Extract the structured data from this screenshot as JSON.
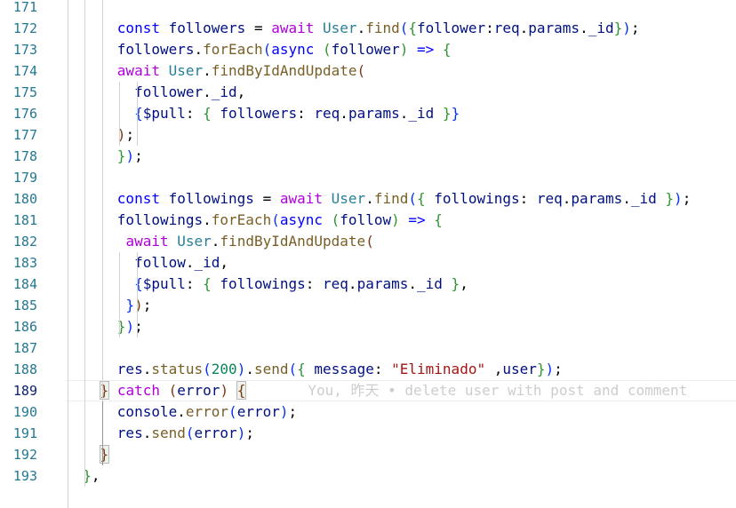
{
  "editor": {
    "colors": {
      "background": "#ffffff",
      "line_number": "#237893",
      "line_number_active": "#0b216f",
      "indent_guide": "#d3d3d3",
      "keyword": "#0000ff",
      "control": "#af00db",
      "variable": "#001080",
      "class": "#267f99",
      "function": "#795e26",
      "string": "#a31515",
      "number": "#098658"
    },
    "lines": [
      {
        "num": "171",
        "tokens": []
      },
      {
        "num": "172",
        "tokens": [
          {
            "t": "      "
          },
          {
            "t": "const",
            "c": "t-kw"
          },
          {
            "t": " "
          },
          {
            "t": "followers",
            "c": "t-var"
          },
          {
            "t": " = "
          },
          {
            "t": "await",
            "c": "t-ctl"
          },
          {
            "t": " "
          },
          {
            "t": "User",
            "c": "t-cls"
          },
          {
            "t": "."
          },
          {
            "t": "find",
            "c": "t-fn"
          },
          {
            "t": "(",
            "c": "t-b1"
          },
          {
            "t": "{",
            "c": "t-b2"
          },
          {
            "t": "follower",
            "c": "t-var"
          },
          {
            "t": ":"
          },
          {
            "t": "req",
            "c": "t-var"
          },
          {
            "t": "."
          },
          {
            "t": "params",
            "c": "t-var"
          },
          {
            "t": "."
          },
          {
            "t": "_id",
            "c": "t-var"
          },
          {
            "t": "}",
            "c": "t-b2"
          },
          {
            "t": ")",
            "c": "t-b1"
          },
          {
            "t": ";"
          }
        ]
      },
      {
        "num": "173",
        "tokens": [
          {
            "t": "      "
          },
          {
            "t": "followers",
            "c": "t-var"
          },
          {
            "t": "."
          },
          {
            "t": "forEach",
            "c": "t-fn"
          },
          {
            "t": "(",
            "c": "t-b1"
          },
          {
            "t": "async",
            "c": "t-kw"
          },
          {
            "t": " "
          },
          {
            "t": "(",
            "c": "t-b2"
          },
          {
            "t": "follower",
            "c": "t-var"
          },
          {
            "t": ")",
            "c": "t-b2"
          },
          {
            "t": " "
          },
          {
            "t": "=>",
            "c": "t-kw"
          },
          {
            "t": " "
          },
          {
            "t": "{",
            "c": "t-b2"
          }
        ]
      },
      {
        "num": "174",
        "tokens": [
          {
            "t": "      "
          },
          {
            "t": "await",
            "c": "t-ctl"
          },
          {
            "t": " "
          },
          {
            "t": "User",
            "c": "t-cls"
          },
          {
            "t": "."
          },
          {
            "t": "findByIdAndUpdate",
            "c": "t-fn"
          },
          {
            "t": "(",
            "c": "t-b3"
          }
        ]
      },
      {
        "num": "175",
        "tokens": [
          {
            "t": "        "
          },
          {
            "t": "follower",
            "c": "t-var"
          },
          {
            "t": "."
          },
          {
            "t": "_id",
            "c": "t-var"
          },
          {
            "t": ","
          }
        ]
      },
      {
        "num": "176",
        "tokens": [
          {
            "t": "        "
          },
          {
            "t": "{",
            "c": "t-b1"
          },
          {
            "t": "$pull",
            "c": "t-var"
          },
          {
            "t": ": "
          },
          {
            "t": "{",
            "c": "t-b2"
          },
          {
            "t": " "
          },
          {
            "t": "followers",
            "c": "t-var"
          },
          {
            "t": ": "
          },
          {
            "t": "req",
            "c": "t-var"
          },
          {
            "t": "."
          },
          {
            "t": "params",
            "c": "t-var"
          },
          {
            "t": "."
          },
          {
            "t": "_id",
            "c": "t-var"
          },
          {
            "t": " "
          },
          {
            "t": "}",
            "c": "t-b2"
          },
          {
            "t": "}",
            "c": "t-b1"
          }
        ]
      },
      {
        "num": "177",
        "tokens": [
          {
            "t": "      "
          },
          {
            "t": ")",
            "c": "t-b3"
          },
          {
            "t": ";"
          }
        ]
      },
      {
        "num": "178",
        "tokens": [
          {
            "t": "      "
          },
          {
            "t": "}",
            "c": "t-b2"
          },
          {
            "t": ")",
            "c": "t-b1"
          },
          {
            "t": ";"
          }
        ]
      },
      {
        "num": "179",
        "tokens": []
      },
      {
        "num": "180",
        "tokens": [
          {
            "t": "      "
          },
          {
            "t": "const",
            "c": "t-kw"
          },
          {
            "t": " "
          },
          {
            "t": "followings",
            "c": "t-var"
          },
          {
            "t": " = "
          },
          {
            "t": "await",
            "c": "t-ctl"
          },
          {
            "t": " "
          },
          {
            "t": "User",
            "c": "t-cls"
          },
          {
            "t": "."
          },
          {
            "t": "find",
            "c": "t-fn"
          },
          {
            "t": "(",
            "c": "t-b1"
          },
          {
            "t": "{",
            "c": "t-b2"
          },
          {
            "t": " "
          },
          {
            "t": "followings",
            "c": "t-var"
          },
          {
            "t": ": "
          },
          {
            "t": "req",
            "c": "t-var"
          },
          {
            "t": "."
          },
          {
            "t": "params",
            "c": "t-var"
          },
          {
            "t": "."
          },
          {
            "t": "_id",
            "c": "t-var"
          },
          {
            "t": " "
          },
          {
            "t": "}",
            "c": "t-b2"
          },
          {
            "t": ")",
            "c": "t-b1"
          },
          {
            "t": ";"
          }
        ]
      },
      {
        "num": "181",
        "tokens": [
          {
            "t": "      "
          },
          {
            "t": "followings",
            "c": "t-var"
          },
          {
            "t": "."
          },
          {
            "t": "forEach",
            "c": "t-fn"
          },
          {
            "t": "(",
            "c": "t-b1"
          },
          {
            "t": "async",
            "c": "t-kw"
          },
          {
            "t": " "
          },
          {
            "t": "(",
            "c": "t-b2"
          },
          {
            "t": "follow",
            "c": "t-var"
          },
          {
            "t": ")",
            "c": "t-b2"
          },
          {
            "t": " "
          },
          {
            "t": "=>",
            "c": "t-kw"
          },
          {
            "t": " "
          },
          {
            "t": "{",
            "c": "t-b2"
          }
        ]
      },
      {
        "num": "182",
        "tokens": [
          {
            "t": "       "
          },
          {
            "t": "await",
            "c": "t-ctl"
          },
          {
            "t": " "
          },
          {
            "t": "User",
            "c": "t-cls"
          },
          {
            "t": "."
          },
          {
            "t": "findByIdAndUpdate",
            "c": "t-fn"
          },
          {
            "t": "(",
            "c": "t-b3"
          }
        ]
      },
      {
        "num": "183",
        "tokens": [
          {
            "t": "        "
          },
          {
            "t": "follow",
            "c": "t-var"
          },
          {
            "t": "."
          },
          {
            "t": "_id",
            "c": "t-var"
          },
          {
            "t": ","
          }
        ]
      },
      {
        "num": "184",
        "tokens": [
          {
            "t": "        "
          },
          {
            "t": "{",
            "c": "t-b1"
          },
          {
            "t": "$pull",
            "c": "t-var"
          },
          {
            "t": ": "
          },
          {
            "t": "{",
            "c": "t-b2"
          },
          {
            "t": " "
          },
          {
            "t": "followings",
            "c": "t-var"
          },
          {
            "t": ": "
          },
          {
            "t": "req",
            "c": "t-var"
          },
          {
            "t": "."
          },
          {
            "t": "params",
            "c": "t-var"
          },
          {
            "t": "."
          },
          {
            "t": "_id",
            "c": "t-var"
          },
          {
            "t": " "
          },
          {
            "t": "}",
            "c": "t-b2"
          },
          {
            "t": ","
          }
        ]
      },
      {
        "num": "185",
        "tokens": [
          {
            "t": "       "
          },
          {
            "t": "}",
            "c": "t-b1"
          },
          {
            "t": ")",
            "c": "t-b3"
          },
          {
            "t": ";"
          }
        ]
      },
      {
        "num": "186",
        "tokens": [
          {
            "t": "      "
          },
          {
            "t": "}",
            "c": "t-b2"
          },
          {
            "t": ")",
            "c": "t-b1"
          },
          {
            "t": ";"
          }
        ]
      },
      {
        "num": "187",
        "tokens": []
      },
      {
        "num": "188",
        "tokens": [
          {
            "t": "      "
          },
          {
            "t": "res",
            "c": "t-var"
          },
          {
            "t": "."
          },
          {
            "t": "status",
            "c": "t-fn"
          },
          {
            "t": "(",
            "c": "t-b1"
          },
          {
            "t": "200",
            "c": "t-num"
          },
          {
            "t": ")",
            "c": "t-b1"
          },
          {
            "t": "."
          },
          {
            "t": "send",
            "c": "t-fn"
          },
          {
            "t": "(",
            "c": "t-b1"
          },
          {
            "t": "{",
            "c": "t-b2"
          },
          {
            "t": " "
          },
          {
            "t": "message",
            "c": "t-var"
          },
          {
            "t": ": "
          },
          {
            "t": "\"Eliminado\"",
            "c": "t-str"
          },
          {
            "t": " ,"
          },
          {
            "t": "user",
            "c": "t-var"
          },
          {
            "t": "}",
            "c": "t-b2"
          },
          {
            "t": ")",
            "c": "t-b1"
          },
          {
            "t": ";"
          }
        ]
      },
      {
        "num": "189",
        "active": true,
        "tokens": [
          {
            "t": "    "
          },
          {
            "t": "}",
            "c": "t-b3 bm"
          },
          {
            "t": " "
          },
          {
            "t": "catch",
            "c": "t-ctl"
          },
          {
            "t": " "
          },
          {
            "t": "(",
            "c": "t-b3"
          },
          {
            "t": "error",
            "c": "t-var"
          },
          {
            "t": ")",
            "c": "t-b3"
          },
          {
            "t": " "
          },
          {
            "t": "{",
            "c": "t-b3 bm"
          }
        ],
        "ghost": "You, 昨天 • delete user with post and comment"
      },
      {
        "num": "190",
        "tokens": [
          {
            "t": "      "
          },
          {
            "t": "console",
            "c": "t-var"
          },
          {
            "t": "."
          },
          {
            "t": "error",
            "c": "t-fn"
          },
          {
            "t": "(",
            "c": "t-b1"
          },
          {
            "t": "error",
            "c": "t-var"
          },
          {
            "t": ")",
            "c": "t-b1"
          },
          {
            "t": ";"
          }
        ]
      },
      {
        "num": "191",
        "tokens": [
          {
            "t": "      "
          },
          {
            "t": "res",
            "c": "t-var"
          },
          {
            "t": "."
          },
          {
            "t": "send",
            "c": "t-fn"
          },
          {
            "t": "(",
            "c": "t-b1"
          },
          {
            "t": "error",
            "c": "t-var"
          },
          {
            "t": ")",
            "c": "t-b1"
          },
          {
            "t": ";"
          }
        ]
      },
      {
        "num": "192",
        "tokens": [
          {
            "t": "    "
          },
          {
            "t": "}",
            "c": "t-b3 bm"
          }
        ]
      },
      {
        "num": "193",
        "tokens": [
          {
            "t": "  "
          },
          {
            "t": "}",
            "c": "t-b2"
          },
          {
            "t": ","
          }
        ]
      }
    ]
  }
}
